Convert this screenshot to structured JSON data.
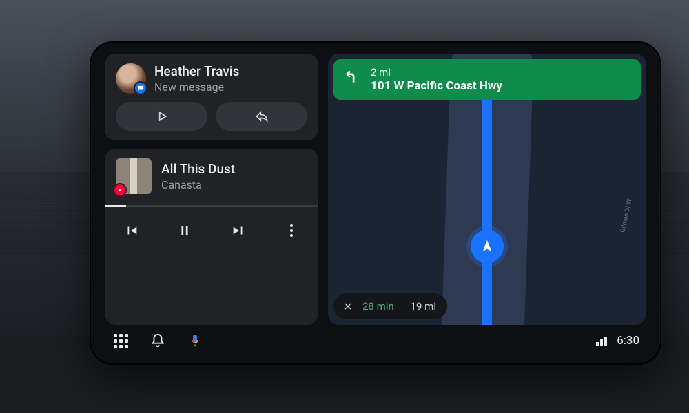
{
  "message_card": {
    "sender": "Heather Travis",
    "subtitle": "New message",
    "app_badge": "messages-icon"
  },
  "music_card": {
    "track": "All This Dust",
    "artist": "Canasta",
    "source_badge": "youtube-music-icon",
    "progress_pct": 10
  },
  "navigation": {
    "turn": {
      "direction": "left",
      "distance": "2 mi",
      "road": "101 W Pacific Coast Hwy"
    },
    "eta": {
      "time": "28 min",
      "distance": "19 mi"
    },
    "street_labels": [
      "Gilman Dr W"
    ]
  },
  "status_bar": {
    "clock": "6:30"
  },
  "colors": {
    "accent_blue": "#1a73ff",
    "nav_banner": "#0f8b4c",
    "eta_time": "#4caf7d"
  }
}
